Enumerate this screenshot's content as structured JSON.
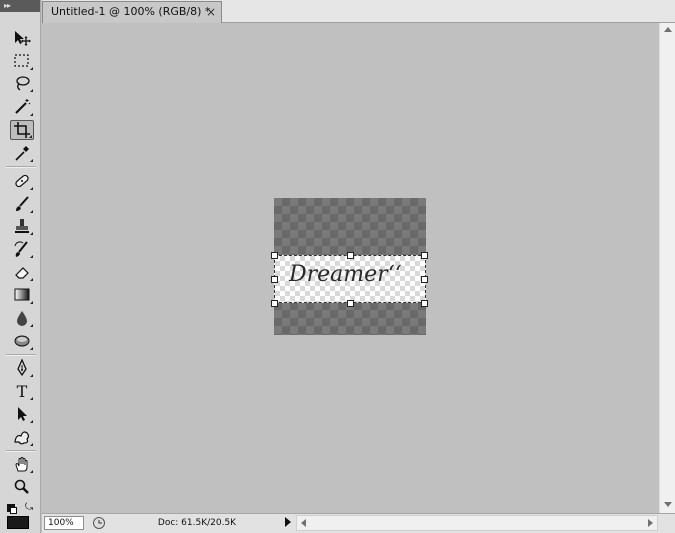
{
  "document": {
    "tab_title": "Untitled-1 @ 100% (RGB/8) *",
    "close_glyph": "×",
    "layer_text": "Dreamer‘‘"
  },
  "status": {
    "zoom": "100%",
    "doc_info": "Doc: 61.5K/20.5K"
  },
  "toolbox": {
    "grip": "▸▸",
    "tools": [
      {
        "name": "move-tool",
        "icon": "move-icon"
      },
      {
        "name": "marquee-tool",
        "icon": "rectangular-marquee-icon"
      },
      {
        "name": "lasso-tool",
        "icon": "lasso-icon"
      },
      {
        "name": "quick-selection-tool",
        "icon": "magic-wand-icon"
      },
      {
        "name": "crop-tool",
        "icon": "crop-icon",
        "active": true
      },
      {
        "name": "eyedropper-tool",
        "icon": "eyedropper-icon"
      },
      {
        "name": "healing-brush-tool",
        "icon": "bandage-icon"
      },
      {
        "name": "brush-tool",
        "icon": "brush-icon"
      },
      {
        "name": "clone-stamp-tool",
        "icon": "stamp-icon"
      },
      {
        "name": "history-brush-tool",
        "icon": "history-brush-icon"
      },
      {
        "name": "eraser-tool",
        "icon": "eraser-icon"
      },
      {
        "name": "gradient-tool",
        "icon": "gradient-icon"
      },
      {
        "name": "blur-tool",
        "icon": "drop-icon"
      },
      {
        "name": "dodge-tool",
        "icon": "sponge-icon"
      },
      {
        "name": "pen-tool",
        "icon": "pen-icon"
      },
      {
        "name": "type-tool",
        "icon": "type-icon"
      },
      {
        "name": "path-selection-tool",
        "icon": "arrow-cursor-icon"
      },
      {
        "name": "custom-shape-tool",
        "icon": "custom-shape-icon"
      },
      {
        "name": "hand-tool",
        "icon": "hand-icon"
      },
      {
        "name": "zoom-tool",
        "icon": "magnifier-icon"
      }
    ],
    "type_tool_glyph": "T"
  },
  "colors": {
    "canvas_bg": "#c0c0c0",
    "foreground": "#1a1a1a",
    "background": "#ffffff"
  }
}
